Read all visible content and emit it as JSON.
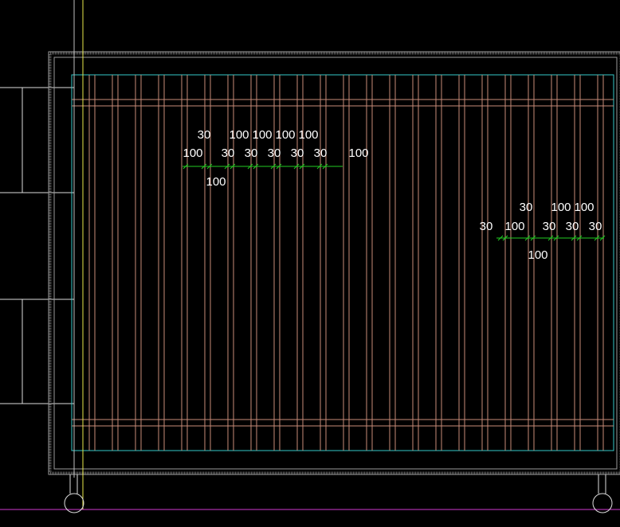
{
  "drawing": {
    "colors": {
      "background": "#000000",
      "wall": "#9a9a9a",
      "inner_border": "#35c8c8",
      "slats": "#c88b78",
      "dimension_line": "#22cc22",
      "dimension_text": "#ffffff",
      "axis_vertical": "#e8e84a",
      "axis_horizontal": "#d23ad2",
      "cabinet_lines": "#dcdcdc"
    },
    "dimension_groups": [
      {
        "top_row": [
          "30",
          "100",
          "100",
          "100",
          "100"
        ],
        "middle_row": [
          "100",
          "30",
          "30",
          "30",
          "30",
          "30",
          "100"
        ],
        "bottom_row": [
          "100"
        ]
      },
      {
        "top_row": [
          "30",
          "100",
          "100"
        ],
        "middle_row": [
          "30",
          "100",
          "30",
          "30",
          "30"
        ],
        "bottom_row": [
          "100"
        ]
      }
    ]
  }
}
